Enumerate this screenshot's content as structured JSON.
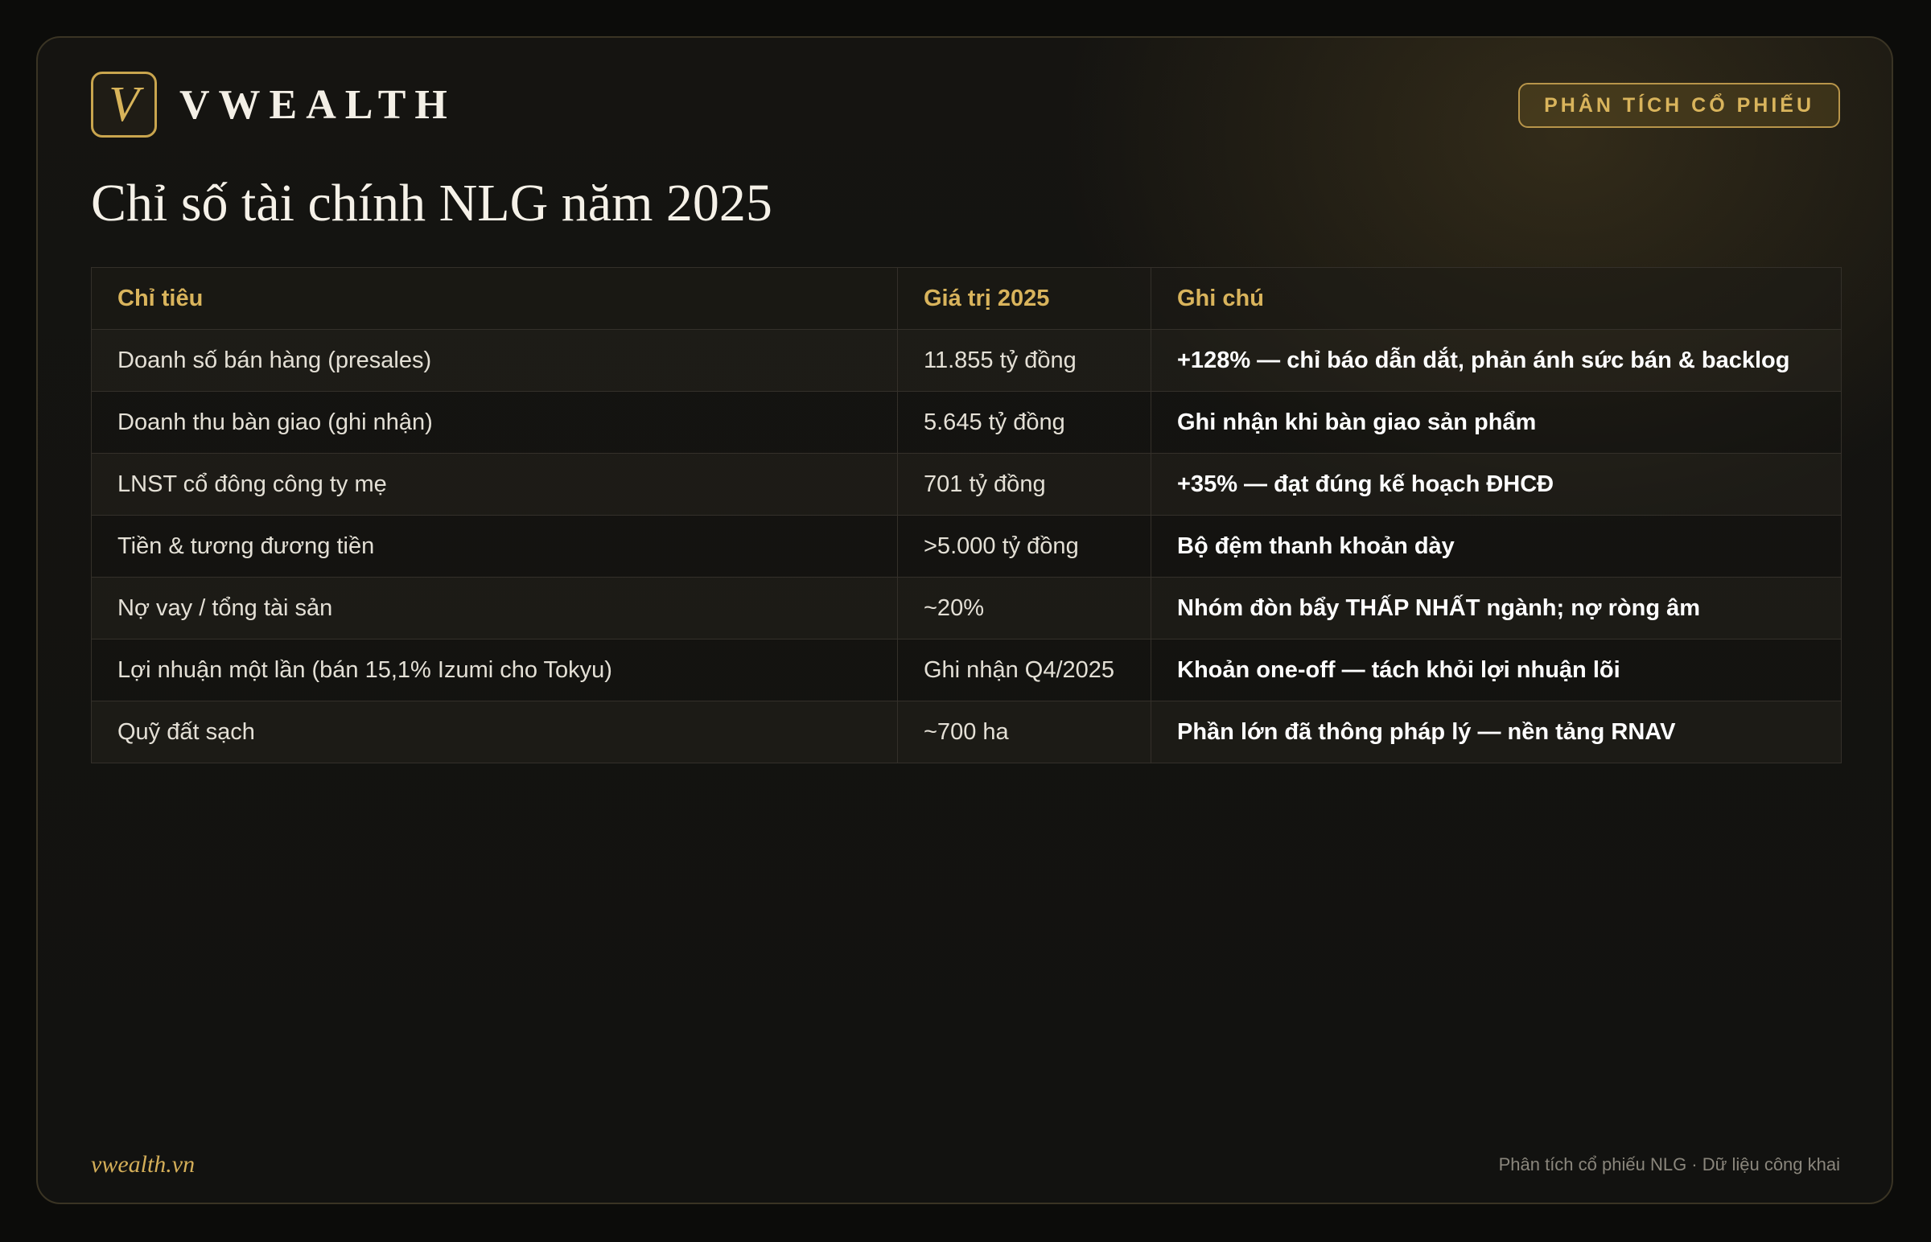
{
  "brand": {
    "logo_letter": "V",
    "name": "VWEALTH"
  },
  "tag": "PHÂN TÍCH CỔ PHIẾU",
  "title": "Chỉ số tài chính NLG năm 2025",
  "table": {
    "headers": [
      "Chỉ tiêu",
      "Giá trị 2025",
      "Ghi chú"
    ],
    "rows": [
      [
        "Doanh số bán hàng (presales)",
        "11.855 tỷ đồng",
        "+128% — chỉ báo dẫn dắt, phản ánh sức bán & backlog"
      ],
      [
        "Doanh thu bàn giao (ghi nhận)",
        "5.645 tỷ đồng",
        "Ghi nhận khi bàn giao sản phẩm"
      ],
      [
        "LNST cổ đông công ty mẹ",
        "701 tỷ đồng",
        "+35% — đạt đúng kế hoạch ĐHCĐ"
      ],
      [
        "Tiền & tương đương tiền",
        ">5.000 tỷ đồng",
        "Bộ đệm thanh khoản dày"
      ],
      [
        "Nợ vay / tổng tài sản",
        "~20%",
        "Nhóm đòn bẩy THẤP NHẤT ngành; nợ ròng âm"
      ],
      [
        "Lợi nhuận một lần (bán 15,1% Izumi cho Tokyu)",
        "Ghi nhận Q4/2025",
        "Khoản one-off — tách khỏi lợi nhuận lõi"
      ],
      [
        "Quỹ đất sạch",
        "~700 ha",
        "Phần lớn đã thông pháp lý — nền tảng RNAV"
      ]
    ]
  },
  "footer": {
    "site": "vwealth.vn",
    "source": "Phân tích cổ phiếu NLG · Dữ liệu công khai"
  },
  "colors": {
    "accent_gold": "#d9b45c",
    "background": "#121210",
    "border": "#34302a"
  }
}
